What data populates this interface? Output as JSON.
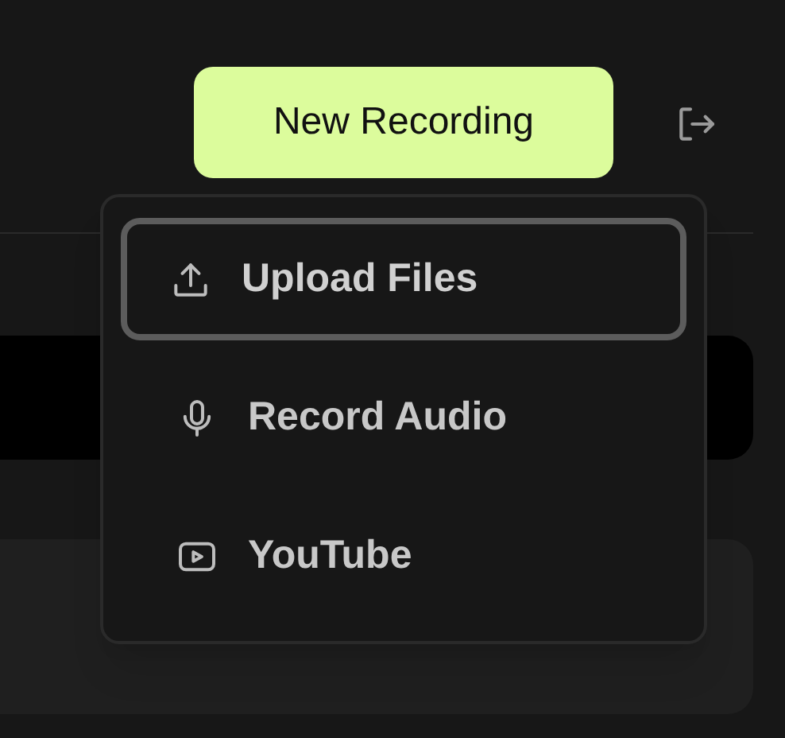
{
  "new_recording_button": {
    "label": "New Recording"
  },
  "menu": {
    "items": [
      {
        "label": "Upload Files",
        "selected": true
      },
      {
        "label": "Record Audio",
        "selected": false
      },
      {
        "label": "YouTube",
        "selected": false
      }
    ]
  }
}
